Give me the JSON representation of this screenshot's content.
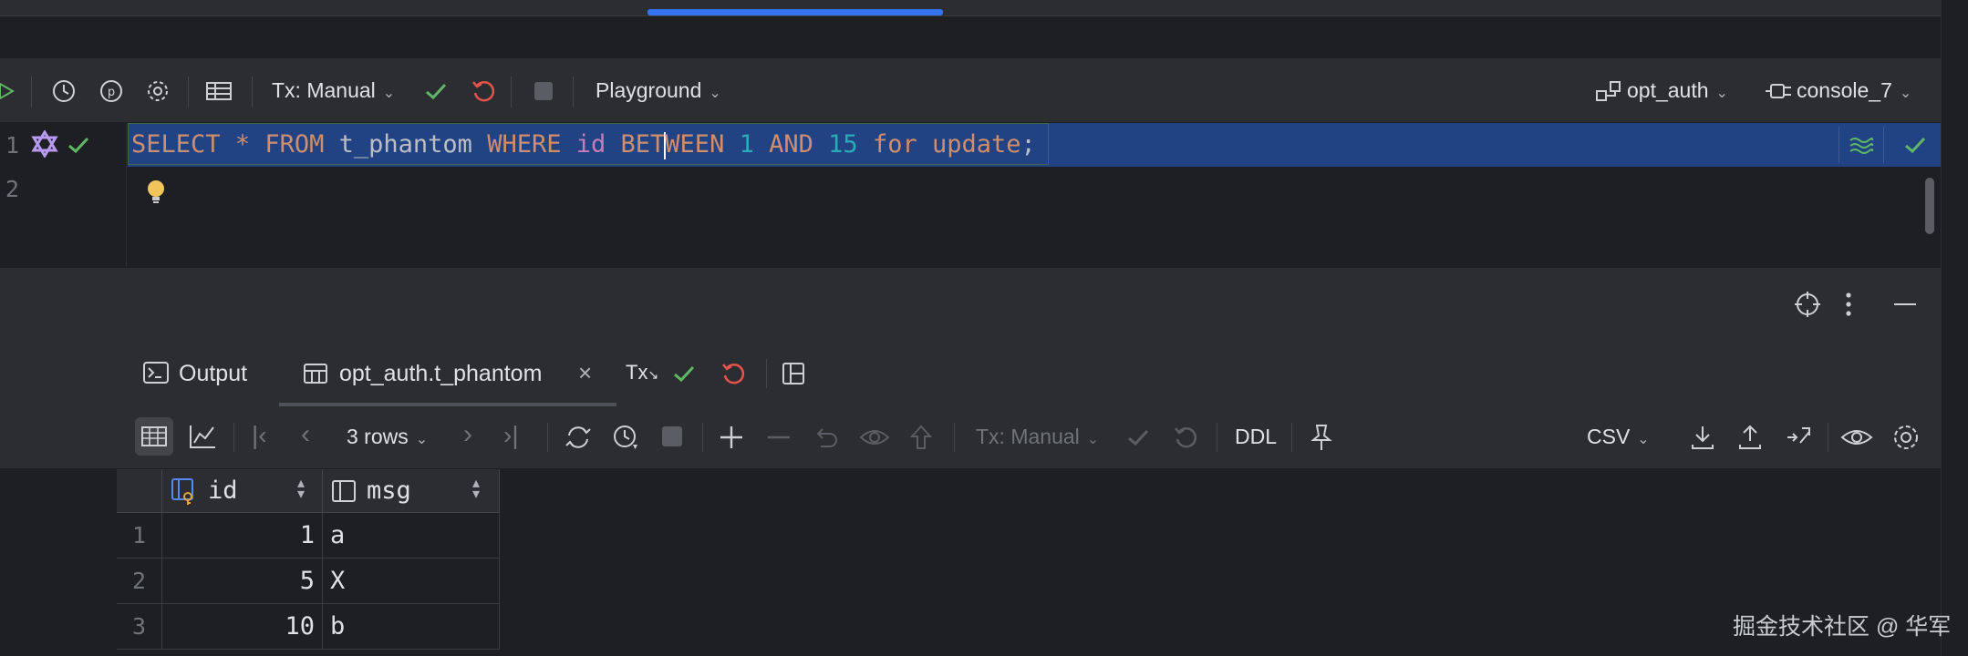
{
  "toolbar": {
    "tx_mode": "Tx: Manual",
    "playground": "Playground",
    "schema": "opt_auth",
    "console": "console_7"
  },
  "editor": {
    "line_numbers": [
      "1",
      "2"
    ],
    "code_tokens": [
      {
        "t": "SELECT",
        "c": "kw"
      },
      {
        "t": " ",
        "c": "plain"
      },
      {
        "t": "*",
        "c": "op"
      },
      {
        "t": " ",
        "c": "plain"
      },
      {
        "t": "FROM",
        "c": "kw"
      },
      {
        "t": " t_phantom ",
        "c": "plain"
      },
      {
        "t": "WHERE",
        "c": "kw"
      },
      {
        "t": " ",
        "c": "plain"
      },
      {
        "t": "id",
        "c": "fld"
      },
      {
        "t": " ",
        "c": "plain"
      },
      {
        "t": "BET",
        "c": "kw"
      },
      {
        "t": "CARET",
        "c": "caret"
      },
      {
        "t": "WEEN",
        "c": "kw"
      },
      {
        "t": " ",
        "c": "plain"
      },
      {
        "t": "1",
        "c": "num"
      },
      {
        "t": " ",
        "c": "plain"
      },
      {
        "t": "AND",
        "c": "kw"
      },
      {
        "t": " ",
        "c": "plain"
      },
      {
        "t": "15",
        "c": "num"
      },
      {
        "t": " ",
        "c": "plain"
      },
      {
        "t": "for",
        "c": "kw"
      },
      {
        "t": " ",
        "c": "plain"
      },
      {
        "t": "update",
        "c": "kw"
      },
      {
        "t": ";",
        "c": "plain"
      }
    ]
  },
  "results": {
    "tabs": {
      "output": "Output",
      "table": "opt_auth.t_phantom",
      "tx": "Tx"
    },
    "toolbar": {
      "rows": "3 rows",
      "tx_mode": "Tx: Manual",
      "ddl": "DDL",
      "format": "CSV"
    },
    "columns": [
      "id",
      "msg"
    ],
    "rows": [
      {
        "num": "1",
        "id": "1",
        "msg": "a"
      },
      {
        "num": "2",
        "id": "5",
        "msg": "X"
      },
      {
        "num": "3",
        "id": "10",
        "msg": "b"
      }
    ]
  },
  "watermark": "掘金技术社区 @ 华军",
  "colors": {
    "selection": "#214283",
    "keyword": "#cf8e6d",
    "number": "#2aacb8",
    "field": "#c77dbb",
    "success": "#5fb865",
    "revert": "#e5534b",
    "accent": "#3574f0"
  }
}
